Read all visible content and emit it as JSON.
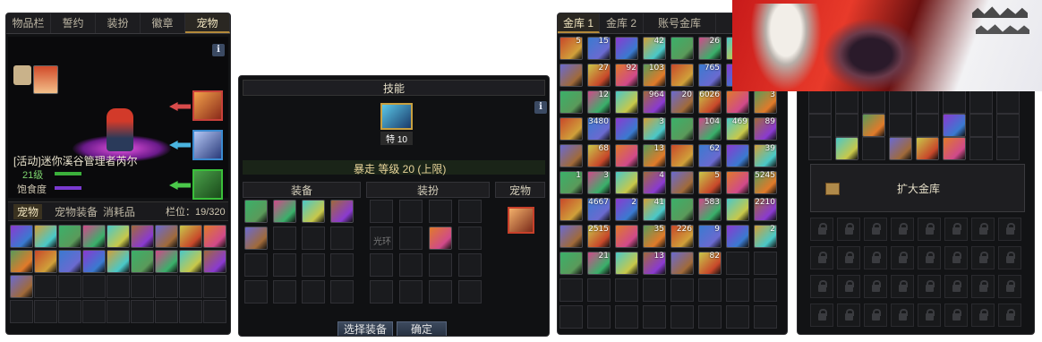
{
  "pet_panel": {
    "tabs": [
      "物品栏",
      "誓约",
      "装扮",
      "徽章",
      "宠物"
    ],
    "pet_name": "[活动]迷你溪谷管理者芮尔",
    "level": "21级",
    "satiety_label": "饱食度",
    "sub_tabs": [
      "宠物",
      "宠物装备",
      "消耗品"
    ],
    "slots_label": "栏位：19/320",
    "info_label": "i"
  },
  "skill_panel": {
    "title": "技能",
    "skill_grade": "特 10",
    "skill_name": "暴走 等级 20 (上限)",
    "info_label": "i",
    "sections": [
      "装备",
      "装扮",
      "宠物"
    ],
    "slot_label": "光环",
    "buttons": [
      "选择装备",
      "确定"
    ]
  },
  "vault_panel": {
    "tabs": [
      "金库 1",
      "金库 2",
      "账号金库",
      "栏"
    ],
    "counts": [
      "5",
      "15",
      "42",
      "26",
      "36",
      "27",
      "92",
      "103",
      "765",
      "752",
      "12",
      "964",
      "20",
      "6026",
      "3",
      "3480",
      "3",
      "104",
      "469",
      "89",
      "68",
      "13",
      "62",
      "39",
      "1",
      "3",
      "4",
      "5",
      "5245",
      "4667",
      "2",
      "41",
      "583",
      "2210",
      "2515",
      "35",
      "226",
      "9",
      "2",
      "21",
      "13",
      "82"
    ],
    "locked_label": "交易"
  },
  "account_vault_panel": {
    "expand_button": "扩大金库"
  },
  "colors": {
    "accent": "#b48a3a",
    "satiety_bar": "#7a3ad0",
    "exp_bar": "#3bb03b",
    "level_text": "#7ed56f",
    "skill_name_text": "#e8d49a",
    "skill_max_text": "#6fdc4a"
  }
}
